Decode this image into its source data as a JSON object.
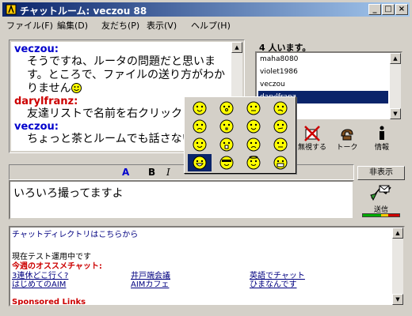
{
  "window": {
    "title": "チャットルーム: veczou 88",
    "controls": [
      "minimize",
      "maximize",
      "close"
    ]
  },
  "menu": [
    {
      "label": "ファイル(F)"
    },
    {
      "label": "編集(D)"
    },
    {
      "label": "友だち(P)"
    },
    {
      "label": "表示(V)"
    },
    {
      "label": "ヘルプ(H)"
    }
  ],
  "chat": {
    "messages": [
      {
        "nick": "veczou:",
        "color": "#0000cc",
        "lines": [
          "そうですね、ルータの問題だと思いま",
          "す。ところで、ファイルの送り方がわか",
          "りません"
        ]
      },
      {
        "nick": "darylfranz:",
        "color": "#cc0000",
        "lines": [
          "友達リストで名前を右クリック"
        ]
      },
      {
        "nick": "veczou:",
        "color": "#0000cc",
        "lines": [
          "ちょっと茶とルームでも話さない"
        ]
      }
    ]
  },
  "members": {
    "count_label": "4 人います。",
    "items": [
      "maha8080",
      "violet1986",
      "veczou",
      "darylfranz"
    ],
    "selected_index": 3
  },
  "actions": {
    "ignore_label": "無視する",
    "talk_label": "トーク",
    "info_label": "情報"
  },
  "format": {
    "bold": "B",
    "italic": "I",
    "font_color_glyph": "A"
  },
  "input": {
    "value": "いろいろ撮ってますよ"
  },
  "side": {
    "hide_label": "非表示",
    "send_label": "送信"
  },
  "directory": {
    "link_text": "チャットディレクトリはこちらから",
    "testing_text": "現在テスト運用中です",
    "featured_heading": "今週のオススメチャット:",
    "links": [
      [
        "3連休どこ行く?",
        "井戸端会議",
        "英語でチャット"
      ],
      [
        "はじめてのAIM",
        "AIMカフェ",
        "ひまなんです"
      ]
    ],
    "footer_partial": "Sponsored Links"
  },
  "emoticons": {
    "selected_index": 12,
    "items": [
      "smile-icon",
      "surprised-icon",
      "cool-neutral-icon",
      "confused-icon",
      "sad-icon",
      "kiss-icon",
      "tongue-icon",
      "undecided-icon",
      "wink-icon",
      "shout-icon",
      "crying-icon",
      "embarrassed-icon",
      "grin-icon",
      "sunglasses-icon",
      "angel-icon",
      "money-mouth-icon"
    ]
  }
}
